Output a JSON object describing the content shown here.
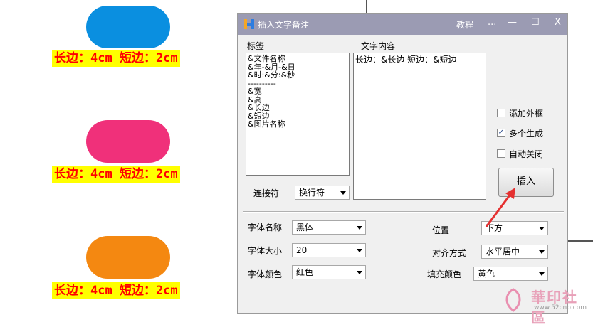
{
  "canvas": {
    "shapes": [
      {
        "color": "#0a8fe0",
        "caption": "长边：4cm 短边：2cm"
      },
      {
        "color": "#f0307a",
        "caption": "长边：4cm 短边：2cm"
      },
      {
        "color": "#f48811",
        "caption": "长边：4cm 短边：2cm"
      }
    ]
  },
  "dialog": {
    "title": "插入文字备注",
    "menu_tutorial": "教程",
    "menu_more": "...",
    "btn_minimize": "—",
    "btn_maximize": "☐",
    "btn_close": "X",
    "tags_label": "标签",
    "content_label": "文字内容",
    "tags": [
      "&文件名称",
      "&年-&月-&日",
      "&时:&分:&秒",
      "----------",
      "&宽",
      "&高",
      "&长边",
      "&短边",
      "&图片名称"
    ],
    "content_value": "长边：&长边 短边：&短边",
    "connector_label": "连接符",
    "connector_value": "换行符",
    "checkboxes": [
      {
        "label": "添加外框",
        "checked": false
      },
      {
        "label": "多个生成",
        "checked": true
      },
      {
        "label": "自动关闭",
        "checked": false
      }
    ],
    "check_mark": "✓",
    "insert_label": "插入",
    "font_name_label": "字体名称",
    "font_name_value": "黑体",
    "font_size_label": "字体大小",
    "font_size_value": "20",
    "font_color_label": "字体颜色",
    "font_color_value": "红色",
    "position_label": "位置",
    "position_value": "下方",
    "align_label": "对齐方式",
    "align_value": "水平居中",
    "fill_color_label": "填充颜色",
    "fill_color_value": "黄色"
  },
  "watermark": {
    "brand": "華印社區",
    "url": "www.52cnp.com"
  },
  "colors": {
    "titlebar": "#9b9bb3",
    "caption_bg": "#ffff00",
    "caption_text": "#ff0000",
    "arrow": "#e53030"
  }
}
